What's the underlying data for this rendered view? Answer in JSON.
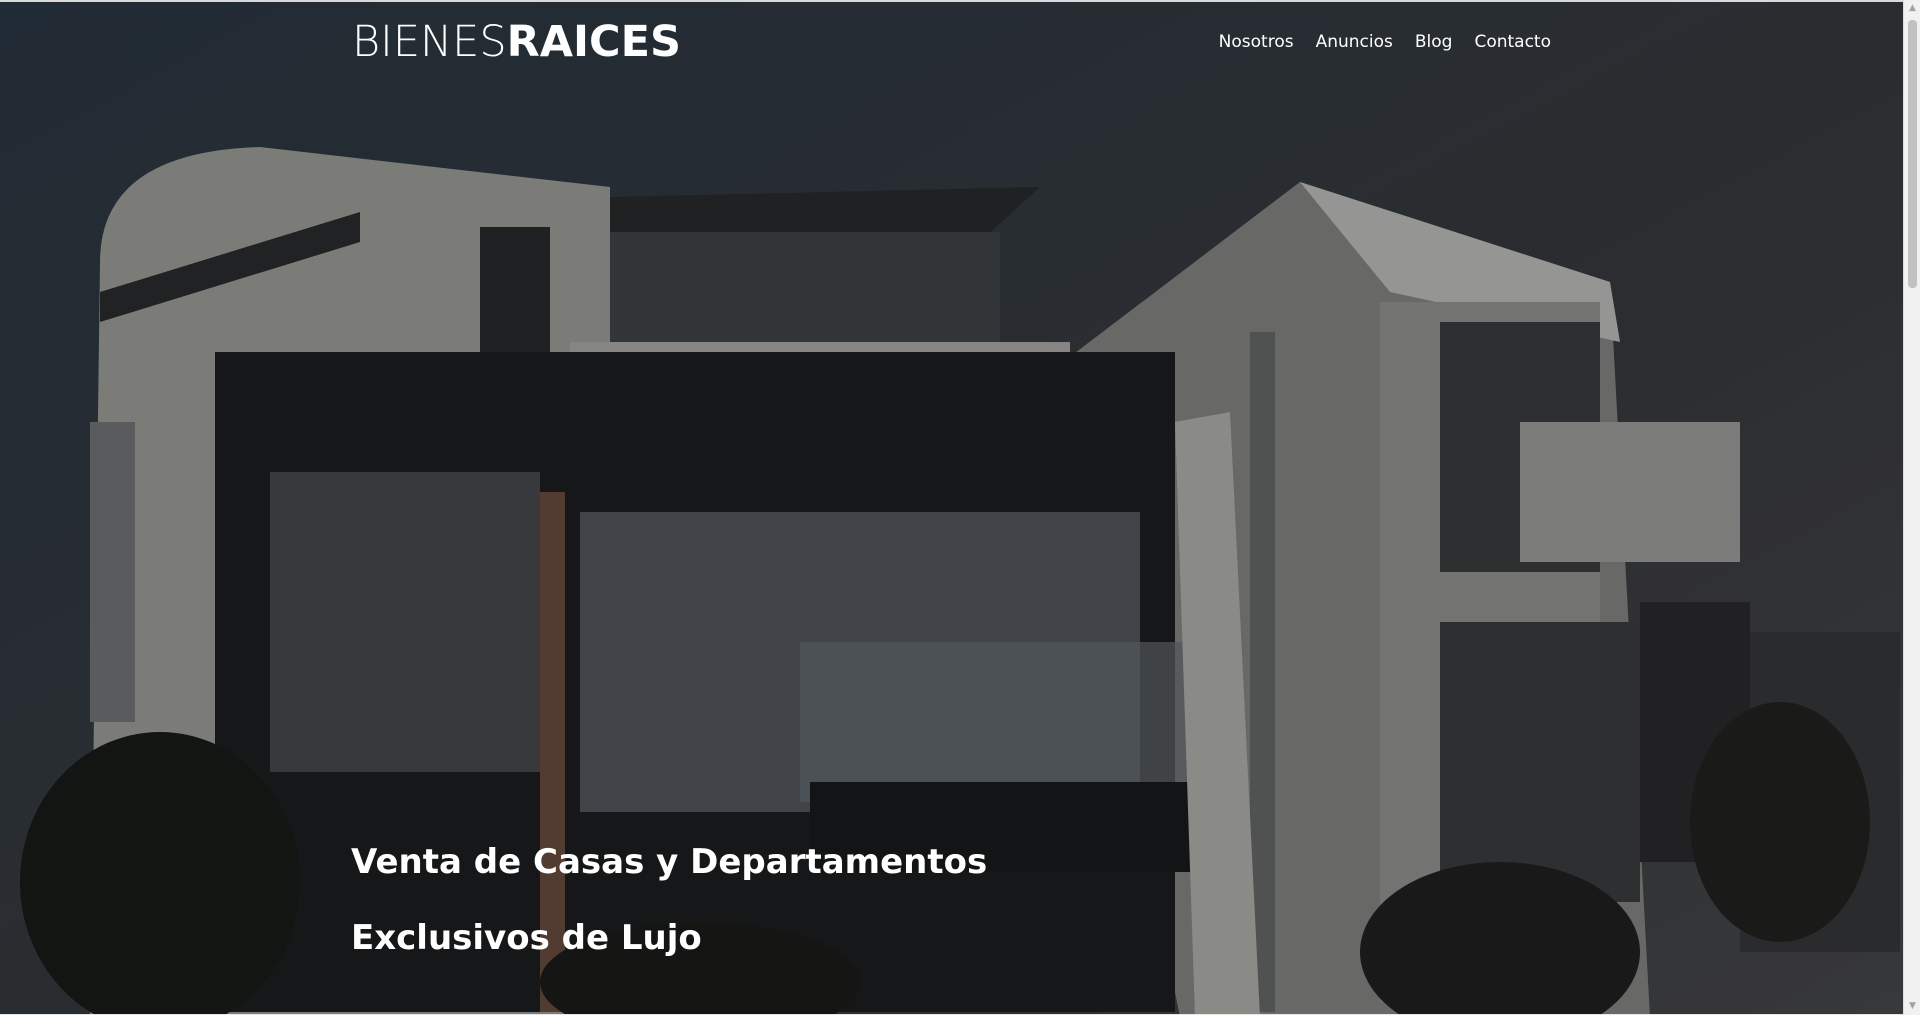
{
  "header": {
    "logo_light": "BIENES",
    "logo_bold": "RAICES",
    "nav": [
      {
        "label": "Nosotros"
      },
      {
        "label": "Anuncios"
      },
      {
        "label": "Blog"
      },
      {
        "label": "Contacto"
      }
    ]
  },
  "hero": {
    "title": "Venta de Casas y Departamentos Exclusivos de Lujo"
  },
  "scrollbar": {
    "up_icon": "▲",
    "down_icon": "▼"
  }
}
